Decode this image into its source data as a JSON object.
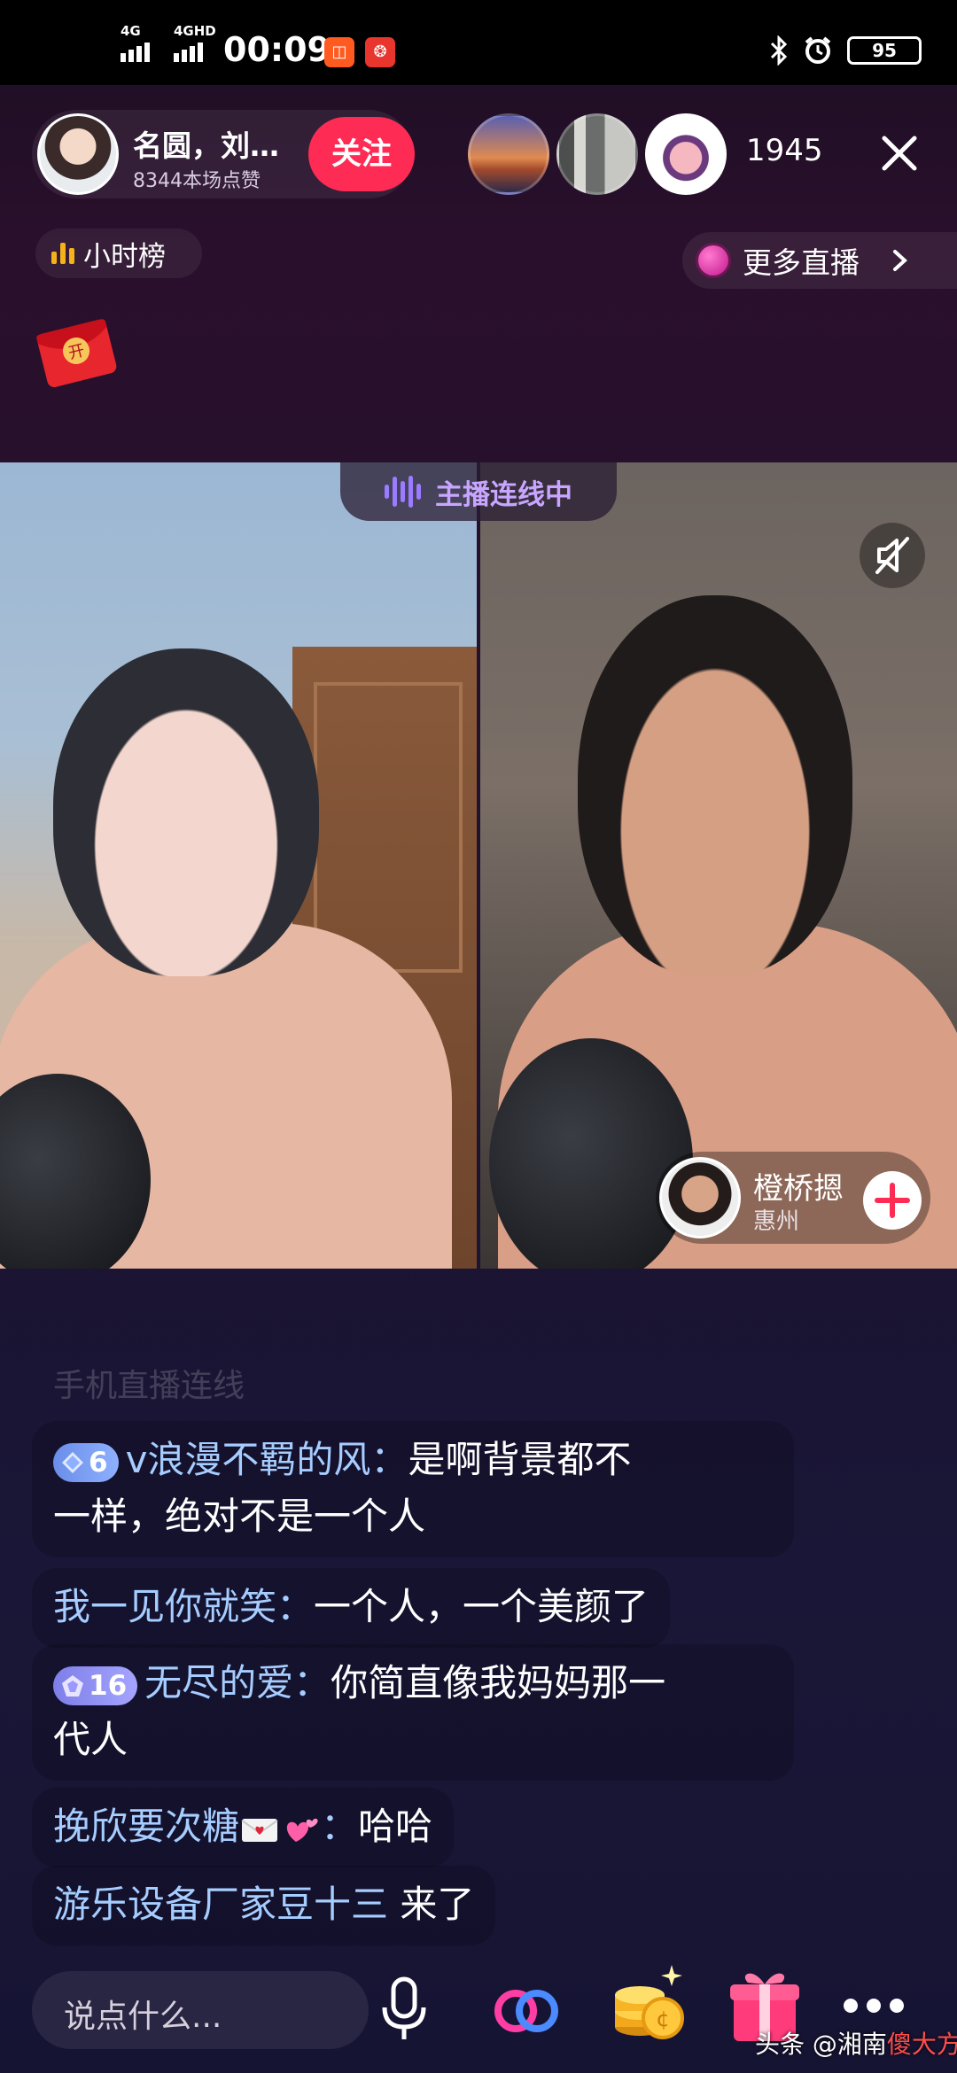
{
  "status_bar": {
    "signal1_label": "4G",
    "signal2_label": "4GHD",
    "time": "00:09",
    "battery": "95"
  },
  "header": {
    "host_name": "名圆，刘…",
    "host_likes": "8344本场点赞",
    "follow_label": "关注",
    "viewer_count": "1945",
    "rank_label": "小时榜",
    "more_live_label": "更多直播"
  },
  "video": {
    "linking_label": "主播连线中",
    "guest_name": "橙桥摁",
    "guest_city": "惠州"
  },
  "comments": {
    "faded": "手机直播连线",
    "c1": {
      "level": "6",
      "user": "v浪漫不羁的风：",
      "text": "是啊背景都不",
      "text2": "一样，绝对不是一个人"
    },
    "c2": {
      "user": "我一见你就笑：",
      "text": "一个人，一个美颜了"
    },
    "c3": {
      "level": "16",
      "user": "无尽的爱：",
      "text": "你简直像我妈妈那一",
      "text2": "代人"
    },
    "c4": {
      "user": "挽欣要次糖",
      "user_suffix": "：",
      "text": "哈哈"
    },
    "c5": {
      "user": "游乐设备厂家豆十三",
      "text": " 来了"
    }
  },
  "bottom": {
    "input_placeholder": "说点什么...",
    "watermark_prefix": "头条 @湘南",
    "watermark_highlight": "傻大方"
  },
  "colors": {
    "follow": "#fe2c55",
    "username": "#a6cdff",
    "linking": "#c8a6ff"
  },
  "icons": [
    "close-icon",
    "rank-bars-icon",
    "planet-icon",
    "chevron-right-icon",
    "red-packet-icon",
    "sound-wave-icon",
    "mute-icon",
    "plus-icon",
    "diamond-badge-icon",
    "envelope-emoji",
    "hearts-emoji",
    "mic-icon",
    "link-icon",
    "coins-icon",
    "gift-icon",
    "more-icon"
  ]
}
